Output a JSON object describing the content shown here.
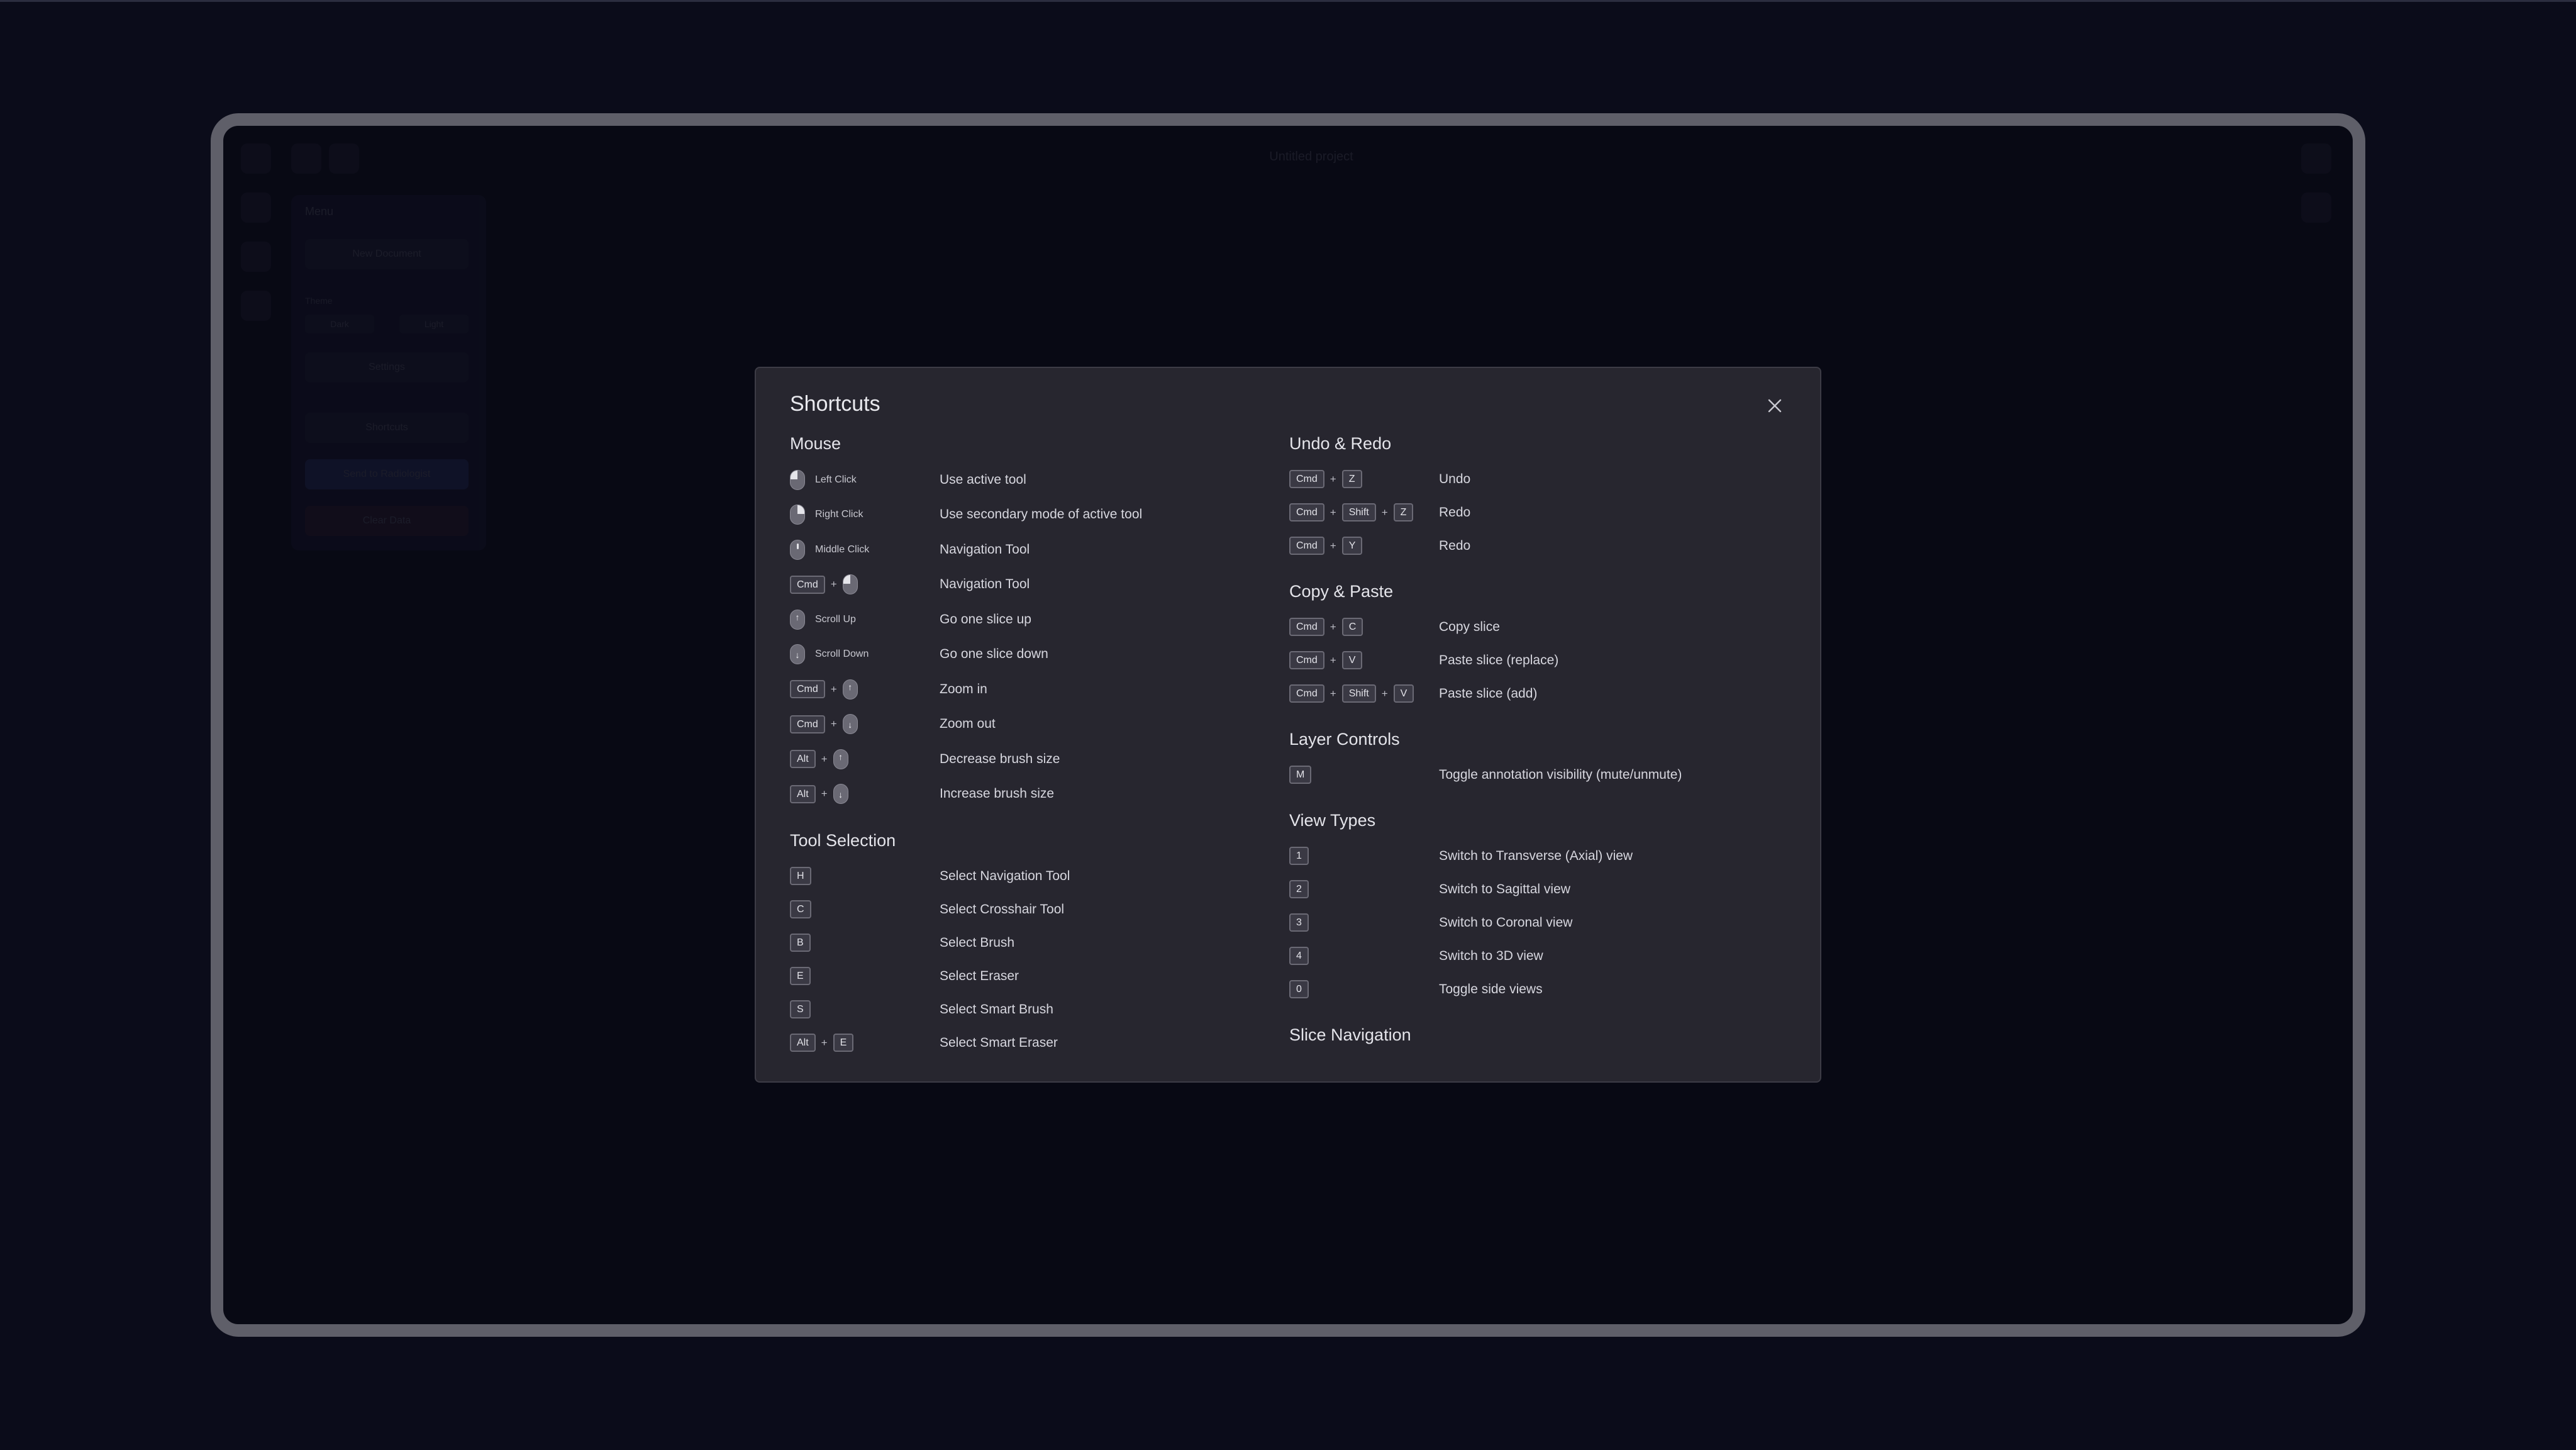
{
  "background_app": {
    "title": "Untitled project",
    "panel_title": "Menu",
    "panel_buttons": [
      "New Document",
      "Settings",
      "Shortcuts",
      "Send to Radiologist",
      "Clear Data"
    ],
    "panel_label": "Theme",
    "panel_chips": [
      "Dark",
      "Light"
    ]
  },
  "modal": {
    "title": "Shortcuts",
    "close_label": "Close",
    "sections": {
      "mouse": {
        "title": "Mouse",
        "rows": [
          {
            "mouse": "left",
            "label": "Left Click",
            "desc": "Use active tool"
          },
          {
            "mouse": "right",
            "label": "Right Click",
            "desc": "Use secondary mode of active tool"
          },
          {
            "mouse": "middle",
            "label": "Middle Click",
            "desc": "Navigation Tool"
          },
          {
            "keys": [
              "Cmd"
            ],
            "mouse": "left",
            "desc": "Navigation Tool"
          },
          {
            "mouse": "scroll-up",
            "label": "Scroll Up",
            "desc": "Go one slice up"
          },
          {
            "mouse": "scroll-down",
            "label": "Scroll Down",
            "desc": "Go one slice down"
          },
          {
            "keys": [
              "Cmd"
            ],
            "mouse": "scroll-up",
            "desc": "Zoom in"
          },
          {
            "keys": [
              "Cmd"
            ],
            "mouse": "scroll-down",
            "desc": "Zoom out"
          },
          {
            "keys": [
              "Alt"
            ],
            "mouse": "scroll-up",
            "desc": "Decrease brush size"
          },
          {
            "keys": [
              "Alt"
            ],
            "mouse": "scroll-down",
            "desc": "Increase brush size"
          }
        ]
      },
      "tool_selection": {
        "title": "Tool Selection",
        "rows": [
          {
            "keys": [
              "H"
            ],
            "desc": "Select Navigation Tool"
          },
          {
            "keys": [
              "C"
            ],
            "desc": "Select Crosshair Tool"
          },
          {
            "keys": [
              "B"
            ],
            "desc": "Select Brush"
          },
          {
            "keys": [
              "E"
            ],
            "desc": "Select Eraser"
          },
          {
            "keys": [
              "S"
            ],
            "desc": "Select Smart Brush"
          },
          {
            "keys": [
              "Alt",
              "E"
            ],
            "desc": "Select Smart Eraser"
          }
        ]
      },
      "undo_redo": {
        "title": "Undo & Redo",
        "rows": [
          {
            "keys": [
              "Cmd",
              "Z"
            ],
            "desc": "Undo"
          },
          {
            "keys": [
              "Cmd",
              "Shift",
              "Z"
            ],
            "desc": "Redo"
          },
          {
            "keys": [
              "Cmd",
              "Y"
            ],
            "desc": "Redo"
          }
        ]
      },
      "copy_paste": {
        "title": "Copy & Paste",
        "rows": [
          {
            "keys": [
              "Cmd",
              "C"
            ],
            "desc": "Copy slice"
          },
          {
            "keys": [
              "Cmd",
              "V"
            ],
            "desc": "Paste slice (replace)"
          },
          {
            "keys": [
              "Cmd",
              "Shift",
              "V"
            ],
            "desc": "Paste slice (add)"
          }
        ]
      },
      "layer_controls": {
        "title": "Layer Controls",
        "rows": [
          {
            "keys": [
              "M"
            ],
            "desc": "Toggle annotation visibility (mute/unmute)"
          }
        ]
      },
      "view_types": {
        "title": "View Types",
        "rows": [
          {
            "keys": [
              "1"
            ],
            "desc": "Switch to Transverse (Axial) view"
          },
          {
            "keys": [
              "2"
            ],
            "desc": "Switch to Sagittal view"
          },
          {
            "keys": [
              "3"
            ],
            "desc": "Switch to Coronal view"
          },
          {
            "keys": [
              "4"
            ],
            "desc": "Switch to 3D view"
          },
          {
            "keys": [
              "0"
            ],
            "desc": "Toggle side views"
          }
        ]
      },
      "slice_navigation": {
        "title": "Slice Navigation",
        "rows": []
      }
    }
  },
  "colors": {
    "page_bg": "#0b0c1a",
    "frame": "#5f5f69",
    "modal_bg": "#27262f",
    "text": "#d7d7df",
    "key_bg": "#3a3944"
  },
  "icons": {
    "close": "close-icon",
    "mouse_left": "mouse-left-click-icon",
    "mouse_right": "mouse-right-click-icon",
    "mouse_middle": "mouse-middle-click-icon",
    "scroll_up": "mouse-scroll-up-icon",
    "scroll_down": "mouse-scroll-down-icon"
  }
}
